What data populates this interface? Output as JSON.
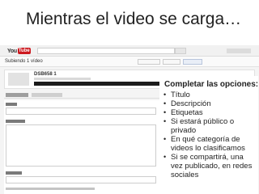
{
  "slide": {
    "title": "Mientras el video se carga…"
  },
  "youtube": {
    "logo_you": "You",
    "logo_tube": "Tube",
    "upload_title": "Subiendo 1 vídeo",
    "video_name": "DSB658 1",
    "upload_progress": 0.72
  },
  "panel": {
    "heading": "Completar las opciones:",
    "items": [
      "Título",
      "Descripción",
      "Etiquetas",
      "Si estará público o privado",
      "En qué categoría de videos lo clasificamos",
      "Si se compartirá, una vez publicado, en redes sociales"
    ]
  },
  "colors": {
    "youtube_red": "#cc181e",
    "progress": "#1b1b1b"
  }
}
